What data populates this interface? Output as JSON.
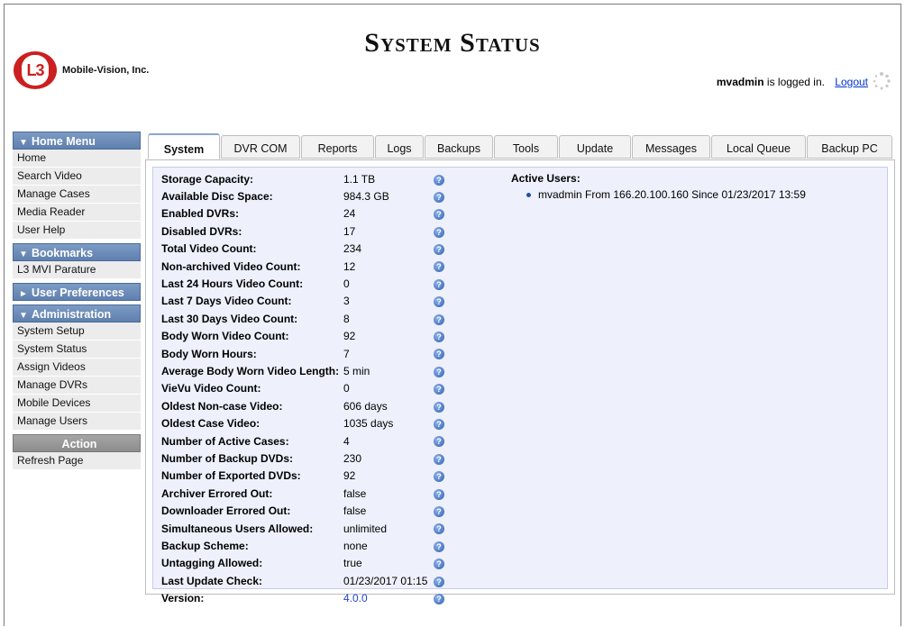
{
  "header": {
    "title": "System Status",
    "company": "Mobile-Vision, Inc.",
    "logo_text": "L3",
    "user": "mvadmin",
    "logged_in_text": "is logged in.",
    "logout": "Logout"
  },
  "sidebar": {
    "sections": [
      {
        "title": "Home Menu",
        "arrow": "▼",
        "items": [
          "Home",
          "Search Video",
          "Manage Cases",
          "Media Reader",
          "User Help"
        ]
      },
      {
        "title": "Bookmarks",
        "arrow": "▼",
        "items": [
          "L3 MVI Parature"
        ]
      },
      {
        "title": "User Preferences",
        "arrow": "►",
        "items": []
      },
      {
        "title": "Administration",
        "arrow": "▼",
        "items": [
          "System Setup",
          "System Status",
          "Assign Videos",
          "Manage DVRs",
          "Mobile Devices",
          "Manage Users"
        ]
      },
      {
        "title": "Action",
        "arrow": "",
        "items": [
          "Refresh Page"
        ]
      }
    ]
  },
  "tabs": [
    "System",
    "DVR COM",
    "Reports",
    "Logs",
    "Backups",
    "Tools",
    "Update",
    "Messages",
    "Local Queue",
    "Backup PC"
  ],
  "active_tab": "System",
  "stats": [
    {
      "label": "Storage Capacity:",
      "value": "1.1 TB"
    },
    {
      "label": "Available Disc Space:",
      "value": "984.3 GB"
    },
    {
      "label": "Enabled DVRs:",
      "value": "24"
    },
    {
      "label": "Disabled DVRs:",
      "value": "17"
    },
    {
      "label": "Total Video Count:",
      "value": "234"
    },
    {
      "label": "Non-archived Video Count:",
      "value": "12"
    },
    {
      "label": "Last 24 Hours Video Count:",
      "value": "0"
    },
    {
      "label": "Last 7 Days Video Count:",
      "value": "3"
    },
    {
      "label": "Last 30 Days Video Count:",
      "value": "8"
    },
    {
      "label": "Body Worn Video Count:",
      "value": "92"
    },
    {
      "label": "Body Worn Hours:",
      "value": "7"
    },
    {
      "label": "Average Body Worn Video Length:",
      "value": "5 min"
    },
    {
      "label": "VieVu Video Count:",
      "value": "0"
    },
    {
      "label": "Oldest Non-case Video:",
      "value": "606 days"
    },
    {
      "label": "Oldest Case Video:",
      "value": "1035 days"
    },
    {
      "label": "Number of Active Cases:",
      "value": "4"
    },
    {
      "label": "Number of Backup DVDs:",
      "value": "230"
    },
    {
      "label": "Number of Exported DVDs:",
      "value": "92"
    },
    {
      "label": "Archiver Errored Out:",
      "value": "false"
    },
    {
      "label": "Downloader Errored Out:",
      "value": "false"
    },
    {
      "label": "Simultaneous Users Allowed:",
      "value": "unlimited"
    },
    {
      "label": "Backup Scheme:",
      "value": "none"
    },
    {
      "label": "Untagging Allowed:",
      "value": "true"
    },
    {
      "label": "Last Update Check:",
      "value": "01/23/2017 01:15"
    },
    {
      "label": "Version:",
      "value": "4.0.0",
      "link": true
    }
  ],
  "active_users": {
    "title": "Active Users:",
    "users": [
      "mvadmin From 166.20.100.160 Since 01/23/2017 13:59"
    ]
  },
  "icons": {
    "help": "help-question-icon",
    "spinner": "loading-spinner-icon"
  },
  "colors": {
    "accent": "#5f7fae",
    "link": "#0033cc",
    "panel_bg": "#eef0fb"
  }
}
